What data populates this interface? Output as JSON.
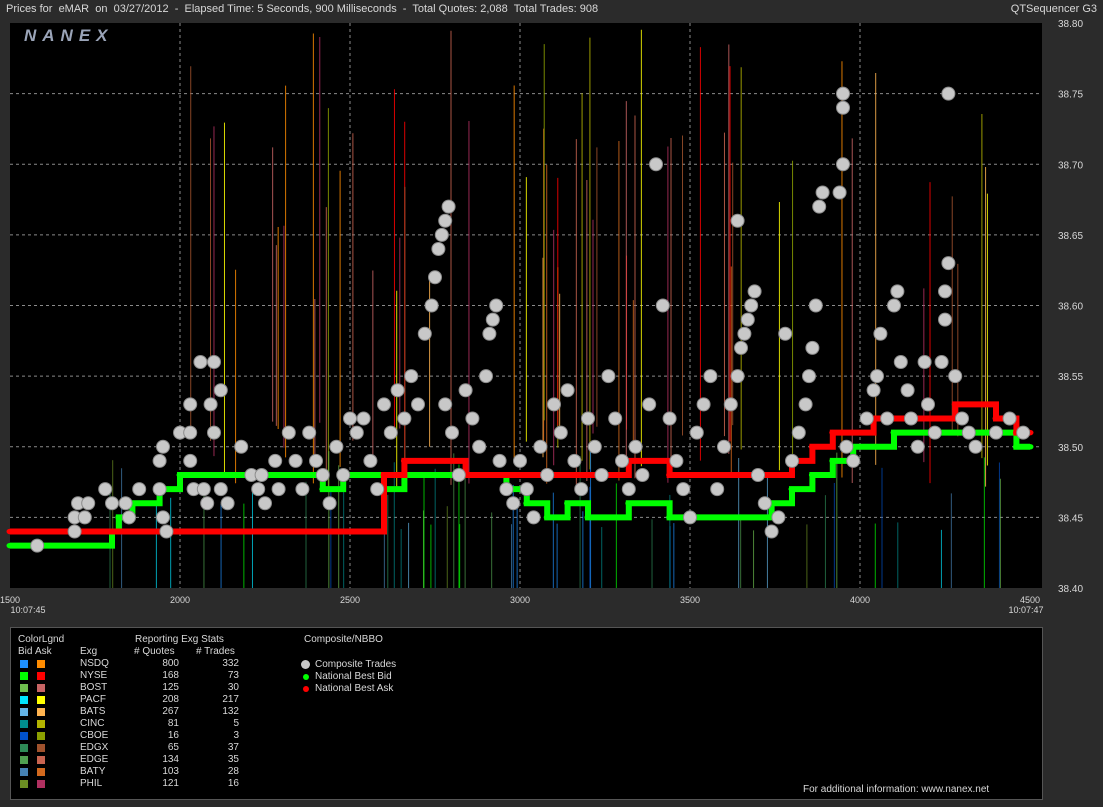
{
  "header": {
    "title_left": "Prices for  eMAR  on  03/27/2012  -  Elapsed Time: 5 Seconds, 900 Milliseconds  -  Total Quotes: 2,088  Total Trades: 908",
    "title_right": "QTSequencer G3",
    "logo_text": "NANEX"
  },
  "chart_data": {
    "type": "scatter",
    "title": "Prices for eMAR on 03/27/2012",
    "xlim": [
      1500,
      4500
    ],
    "ylim": [
      38.4,
      38.8
    ],
    "x_ticks": [
      1500,
      2000,
      2500,
      3000,
      3500,
      4000,
      4500
    ],
    "x_tick_labels": [
      "1500",
      "2000",
      "2500",
      "3000",
      "3500",
      "4000",
      "4500"
    ],
    "x_time_labels": {
      "start": "10:07:45",
      "end": "10:07:47"
    },
    "y_ticks": [
      38.4,
      38.45,
      38.5,
      38.55,
      38.6,
      38.65,
      38.7,
      38.75,
      38.8
    ],
    "y_tick_labels": [
      "38.40",
      "38.45",
      "38.50",
      "38.55",
      "38.60",
      "38.65",
      "38.70",
      "38.75",
      "38.80"
    ],
    "grid": true,
    "colors": {
      "trade": "#c8c8c8",
      "best_bid": "#00ff00",
      "best_ask": "#ff0000",
      "grid": "#8a8a8a"
    },
    "series": [
      {
        "name": "Composite Trades",
        "points": [
          [
            1580,
            38.43
          ],
          [
            1690,
            38.44
          ],
          [
            1690,
            38.45
          ],
          [
            1700,
            38.46
          ],
          [
            1720,
            38.45
          ],
          [
            1730,
            38.46
          ],
          [
            1780,
            38.47
          ],
          [
            1800,
            38.46
          ],
          [
            1840,
            38.46
          ],
          [
            1850,
            38.45
          ],
          [
            1880,
            38.47
          ],
          [
            1940,
            38.49
          ],
          [
            1950,
            38.5
          ],
          [
            1940,
            38.47
          ],
          [
            1950,
            38.45
          ],
          [
            1960,
            38.44
          ],
          [
            2000,
            38.51
          ],
          [
            2030,
            38.53
          ],
          [
            2030,
            38.51
          ],
          [
            2030,
            38.49
          ],
          [
            2040,
            38.47
          ],
          [
            2060,
            38.56
          ],
          [
            2070,
            38.47
          ],
          [
            2080,
            38.46
          ],
          [
            2090,
            38.53
          ],
          [
            2100,
            38.56
          ],
          [
            2100,
            38.51
          ],
          [
            2120,
            38.54
          ],
          [
            2120,
            38.47
          ],
          [
            2140,
            38.46
          ],
          [
            2180,
            38.5
          ],
          [
            2210,
            38.48
          ],
          [
            2230,
            38.47
          ],
          [
            2240,
            38.48
          ],
          [
            2250,
            38.46
          ],
          [
            2280,
            38.49
          ],
          [
            2290,
            38.47
          ],
          [
            2320,
            38.51
          ],
          [
            2340,
            38.49
          ],
          [
            2360,
            38.47
          ],
          [
            2380,
            38.51
          ],
          [
            2400,
            38.49
          ],
          [
            2420,
            38.48
          ],
          [
            2440,
            38.46
          ],
          [
            2460,
            38.5
          ],
          [
            2480,
            38.48
          ],
          [
            2500,
            38.52
          ],
          [
            2520,
            38.51
          ],
          [
            2540,
            38.52
          ],
          [
            2560,
            38.49
          ],
          [
            2580,
            38.47
          ],
          [
            2600,
            38.53
          ],
          [
            2620,
            38.51
          ],
          [
            2640,
            38.54
          ],
          [
            2660,
            38.52
          ],
          [
            2680,
            38.55
          ],
          [
            2700,
            38.53
          ],
          [
            2720,
            38.58
          ],
          [
            2740,
            38.6
          ],
          [
            2750,
            38.62
          ],
          [
            2760,
            38.64
          ],
          [
            2770,
            38.65
          ],
          [
            2780,
            38.66
          ],
          [
            2790,
            38.67
          ],
          [
            2780,
            38.53
          ],
          [
            2800,
            38.51
          ],
          [
            2820,
            38.48
          ],
          [
            2840,
            38.54
          ],
          [
            2860,
            38.52
          ],
          [
            2880,
            38.5
          ],
          [
            2900,
            38.55
          ],
          [
            2910,
            38.58
          ],
          [
            2920,
            38.59
          ],
          [
            2930,
            38.6
          ],
          [
            2940,
            38.49
          ],
          [
            2960,
            38.47
          ],
          [
            2980,
            38.46
          ],
          [
            3000,
            38.49
          ],
          [
            3020,
            38.47
          ],
          [
            3040,
            38.45
          ],
          [
            3060,
            38.5
          ],
          [
            3080,
            38.48
          ],
          [
            3100,
            38.53
          ],
          [
            3120,
            38.51
          ],
          [
            3140,
            38.54
          ],
          [
            3160,
            38.49
          ],
          [
            3180,
            38.47
          ],
          [
            3200,
            38.52
          ],
          [
            3220,
            38.5
          ],
          [
            3240,
            38.48
          ],
          [
            3260,
            38.55
          ],
          [
            3280,
            38.52
          ],
          [
            3300,
            38.49
          ],
          [
            3320,
            38.47
          ],
          [
            3340,
            38.5
          ],
          [
            3360,
            38.48
          ],
          [
            3380,
            38.53
          ],
          [
            3400,
            38.7
          ],
          [
            3420,
            38.6
          ],
          [
            3440,
            38.52
          ],
          [
            3460,
            38.49
          ],
          [
            3480,
            38.47
          ],
          [
            3500,
            38.45
          ],
          [
            3520,
            38.51
          ],
          [
            3540,
            38.53
          ],
          [
            3560,
            38.55
          ],
          [
            3580,
            38.47
          ],
          [
            3600,
            38.5
          ],
          [
            3620,
            38.53
          ],
          [
            3640,
            38.55
          ],
          [
            3650,
            38.57
          ],
          [
            3660,
            38.58
          ],
          [
            3670,
            38.59
          ],
          [
            3680,
            38.6
          ],
          [
            3690,
            38.61
          ],
          [
            3640,
            38.66
          ],
          [
            3700,
            38.48
          ],
          [
            3720,
            38.46
          ],
          [
            3740,
            38.44
          ],
          [
            3760,
            38.45
          ],
          [
            3780,
            38.58
          ],
          [
            3800,
            38.49
          ],
          [
            3820,
            38.51
          ],
          [
            3840,
            38.53
          ],
          [
            3850,
            38.55
          ],
          [
            3860,
            38.57
          ],
          [
            3870,
            38.6
          ],
          [
            3880,
            38.67
          ],
          [
            3890,
            38.68
          ],
          [
            3940,
            38.68
          ],
          [
            3950,
            38.7
          ],
          [
            3950,
            38.74
          ],
          [
            3950,
            38.75
          ],
          [
            3960,
            38.5
          ],
          [
            3980,
            38.49
          ],
          [
            4020,
            38.52
          ],
          [
            4040,
            38.54
          ],
          [
            4050,
            38.55
          ],
          [
            4060,
            38.58
          ],
          [
            4080,
            38.52
          ],
          [
            4100,
            38.6
          ],
          [
            4110,
            38.61
          ],
          [
            4120,
            38.56
          ],
          [
            4140,
            38.54
          ],
          [
            4150,
            38.52
          ],
          [
            4170,
            38.5
          ],
          [
            4190,
            38.56
          ],
          [
            4200,
            38.53
          ],
          [
            4220,
            38.51
          ],
          [
            4240,
            38.56
          ],
          [
            4250,
            38.59
          ],
          [
            4250,
            38.61
          ],
          [
            4260,
            38.63
          ],
          [
            4260,
            38.75
          ],
          [
            4280,
            38.55
          ],
          [
            4300,
            38.52
          ],
          [
            4320,
            38.51
          ],
          [
            4340,
            38.5
          ],
          [
            4400,
            38.51
          ],
          [
            4440,
            38.52
          ],
          [
            4480,
            38.51
          ]
        ]
      },
      {
        "name": "National Best Bid",
        "points": [
          [
            1500,
            38.43
          ],
          [
            1560,
            38.43
          ],
          [
            1620,
            38.43
          ],
          [
            1700,
            38.43
          ],
          [
            1760,
            38.43
          ],
          [
            1800,
            38.44
          ],
          [
            1820,
            38.45
          ],
          [
            1860,
            38.46
          ],
          [
            1900,
            38.46
          ],
          [
            1940,
            38.47
          ],
          [
            2000,
            38.48
          ],
          [
            2060,
            38.48
          ],
          [
            2120,
            38.48
          ],
          [
            2180,
            38.48
          ],
          [
            2240,
            38.48
          ],
          [
            2300,
            38.48
          ],
          [
            2360,
            38.48
          ],
          [
            2420,
            38.47
          ],
          [
            2480,
            38.48
          ],
          [
            2540,
            38.48
          ],
          [
            2600,
            38.47
          ],
          [
            2660,
            38.48
          ],
          [
            2720,
            38.48
          ],
          [
            2780,
            38.48
          ],
          [
            2840,
            38.48
          ],
          [
            2900,
            38.48
          ],
          [
            2960,
            38.47
          ],
          [
            3020,
            38.46
          ],
          [
            3080,
            38.45
          ],
          [
            3140,
            38.46
          ],
          [
            3200,
            38.45
          ],
          [
            3260,
            38.45
          ],
          [
            3320,
            38.46
          ],
          [
            3380,
            38.46
          ],
          [
            3440,
            38.45
          ],
          [
            3500,
            38.45
          ],
          [
            3560,
            38.45
          ],
          [
            3620,
            38.45
          ],
          [
            3680,
            38.45
          ],
          [
            3740,
            38.46
          ],
          [
            3800,
            38.47
          ],
          [
            3860,
            38.48
          ],
          [
            3920,
            38.49
          ],
          [
            3980,
            38.5
          ],
          [
            4040,
            38.5
          ],
          [
            4100,
            38.51
          ],
          [
            4160,
            38.51
          ],
          [
            4220,
            38.51
          ],
          [
            4280,
            38.51
          ],
          [
            4340,
            38.51
          ],
          [
            4400,
            38.51
          ],
          [
            4460,
            38.5
          ],
          [
            4500,
            38.5
          ]
        ]
      },
      {
        "name": "National Best Ask",
        "points": [
          [
            1500,
            38.44
          ],
          [
            1560,
            38.44
          ],
          [
            1620,
            38.44
          ],
          [
            1700,
            38.44
          ],
          [
            1760,
            38.44
          ],
          [
            1800,
            38.44
          ],
          [
            1860,
            38.44
          ],
          [
            1920,
            38.44
          ],
          [
            1980,
            38.44
          ],
          [
            2040,
            38.44
          ],
          [
            2100,
            38.44
          ],
          [
            2160,
            38.44
          ],
          [
            2220,
            38.44
          ],
          [
            2280,
            38.44
          ],
          [
            2340,
            38.44
          ],
          [
            2400,
            38.44
          ],
          [
            2460,
            38.44
          ],
          [
            2520,
            38.44
          ],
          [
            2600,
            38.48
          ],
          [
            2660,
            38.49
          ],
          [
            2720,
            38.49
          ],
          [
            2780,
            38.49
          ],
          [
            2840,
            38.48
          ],
          [
            2900,
            38.48
          ],
          [
            2960,
            38.48
          ],
          [
            3020,
            38.48
          ],
          [
            3080,
            38.48
          ],
          [
            3140,
            38.48
          ],
          [
            3200,
            38.48
          ],
          [
            3260,
            38.48
          ],
          [
            3320,
            38.49
          ],
          [
            3380,
            38.49
          ],
          [
            3440,
            38.48
          ],
          [
            3500,
            38.48
          ],
          [
            3560,
            38.48
          ],
          [
            3620,
            38.48
          ],
          [
            3680,
            38.48
          ],
          [
            3740,
            38.48
          ],
          [
            3800,
            38.49
          ],
          [
            3860,
            38.5
          ],
          [
            3920,
            38.51
          ],
          [
            3980,
            38.51
          ],
          [
            4040,
            38.52
          ],
          [
            4100,
            38.52
          ],
          [
            4160,
            38.52
          ],
          [
            4220,
            38.52
          ],
          [
            4280,
            38.53
          ],
          [
            4340,
            38.53
          ],
          [
            4400,
            38.52
          ],
          [
            4460,
            38.51
          ],
          [
            4500,
            38.51
          ]
        ]
      }
    ]
  },
  "stats": {
    "colorlgnd_label": "ColorLgnd",
    "bid_label": "Bid",
    "ask_label": "Ask",
    "exg_label": "Exg",
    "section_title": "Reporting Exg Stats",
    "quotes_label": "# Quotes",
    "trades_label": "# Trades",
    "rows": [
      {
        "exg": "NSDQ",
        "quotes": "800",
        "trades": "332",
        "bid_color": "#1e90ff",
        "ask_color": "#ff8c00"
      },
      {
        "exg": "NYSE",
        "quotes": "168",
        "trades": "73",
        "bid_color": "#00ff00",
        "ask_color": "#ff0000"
      },
      {
        "exg": "BOST",
        "quotes": "125",
        "trades": "30",
        "bid_color": "#6fbf4f",
        "ask_color": "#c86464"
      },
      {
        "exg": "PACF",
        "quotes": "208",
        "trades": "217",
        "bid_color": "#00e5ff",
        "ask_color": "#ffff00"
      },
      {
        "exg": "BATS",
        "quotes": "267",
        "trades": "132",
        "bid_color": "#64b4e6",
        "ask_color": "#ffb450"
      },
      {
        "exg": "CINC",
        "quotes": "81",
        "trades": "5",
        "bid_color": "#008c8c",
        "ask_color": "#b4b400"
      },
      {
        "exg": "CBOE",
        "quotes": "16",
        "trades": "3",
        "bid_color": "#0050c8",
        "ask_color": "#8ca000"
      },
      {
        "exg": "EDGX",
        "quotes": "65",
        "trades": "37",
        "bid_color": "#2e8b57",
        "ask_color": "#a0522d"
      },
      {
        "exg": "EDGE",
        "quotes": "134",
        "trades": "35",
        "bid_color": "#50a050",
        "ask_color": "#c86450"
      },
      {
        "exg": "BATY",
        "quotes": "103",
        "trades": "28",
        "bid_color": "#4682b4",
        "ask_color": "#d2691e"
      },
      {
        "exg": "PHIL",
        "quotes": "121",
        "trades": "16",
        "bid_color": "#6b8e23",
        "ask_color": "#b03060"
      }
    ]
  },
  "composite": {
    "title": "Composite/NBBO",
    "items": [
      {
        "label": "Composite Trades",
        "color": "#c8c8c8"
      },
      {
        "label": "National Best Bid",
        "color": "#00ff00"
      },
      {
        "label": "National Best Ask",
        "color": "#ff0000"
      }
    ]
  },
  "footer": {
    "info": "For additional information: www.nanex.net"
  }
}
